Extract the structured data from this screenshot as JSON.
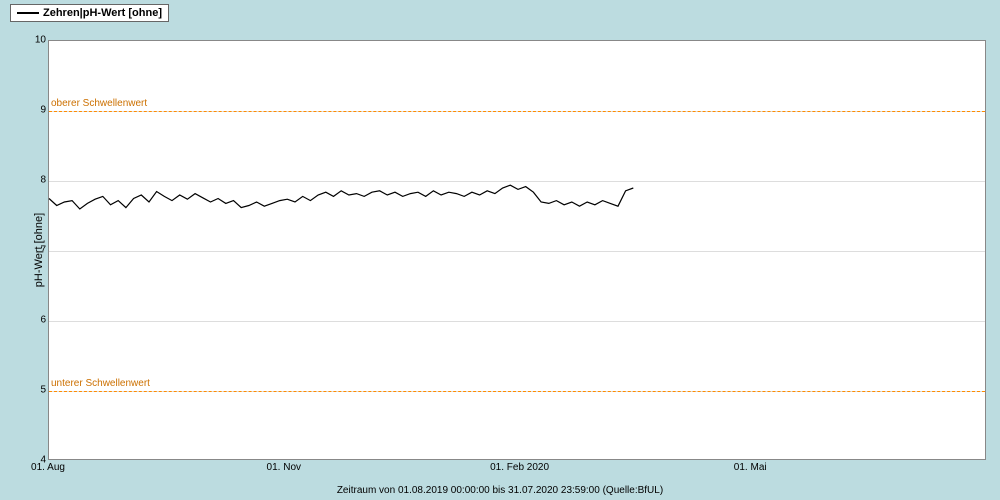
{
  "legend": {
    "label": "Zehren|pH-Wert [ohne]"
  },
  "yaxis": {
    "label": "pH-Wert [ohne]"
  },
  "xaxis": {
    "caption": "Zeitraum von 01.08.2019 00:00:00 bis 31.07.2020 23:59:00        (Quelle:BfUL)"
  },
  "thresholds": {
    "upper_label": "oberer Schwellenwert",
    "lower_label": "unterer Schwellenwert"
  },
  "chart_data": {
    "type": "line",
    "title": "Zehren|pH-Wert [ohne]",
    "xlabel": "Zeitraum von 01.08.2019 00:00:00 bis 31.07.2020 23:59:00",
    "ylabel": "pH-Wert [ohne]",
    "ylim": [
      4,
      10
    ],
    "y_ticks": [
      4,
      5,
      6,
      7,
      8,
      9,
      10
    ],
    "x_ticks": [
      "01. Aug",
      "01. Nov",
      "01. Feb 2020",
      "01. Mai"
    ],
    "x_range_days": [
      0,
      366
    ],
    "x_tick_days": [
      0,
      92,
      184,
      274
    ],
    "thresholds": {
      "upper": 9,
      "lower": 5
    },
    "series": [
      {
        "name": "Zehren pH",
        "x_days": [
          0,
          3,
          6,
          9,
          12,
          15,
          18,
          21,
          24,
          27,
          30,
          33,
          36,
          39,
          42,
          45,
          48,
          51,
          54,
          57,
          60,
          63,
          66,
          69,
          72,
          75,
          78,
          81,
          84,
          87,
          90,
          93,
          96,
          99,
          102,
          105,
          108,
          111,
          114,
          117,
          120,
          123,
          126,
          129,
          132,
          135,
          138,
          141,
          144,
          147,
          150,
          153,
          156,
          159,
          162,
          165,
          168,
          171,
          174,
          177,
          180,
          183,
          186,
          189,
          192,
          195,
          198,
          201,
          204,
          207,
          210,
          213,
          216,
          219,
          222,
          225,
          228
        ],
        "values": [
          7.75,
          7.65,
          7.7,
          7.72,
          7.6,
          7.68,
          7.74,
          7.78,
          7.66,
          7.72,
          7.62,
          7.75,
          7.8,
          7.7,
          7.85,
          7.78,
          7.72,
          7.8,
          7.74,
          7.82,
          7.76,
          7.7,
          7.75,
          7.68,
          7.72,
          7.62,
          7.65,
          7.7,
          7.64,
          7.68,
          7.72,
          7.74,
          7.7,
          7.78,
          7.72,
          7.8,
          7.84,
          7.78,
          7.86,
          7.8,
          7.82,
          7.78,
          7.84,
          7.86,
          7.8,
          7.84,
          7.78,
          7.82,
          7.84,
          7.78,
          7.86,
          7.8,
          7.84,
          7.82,
          7.78,
          7.84,
          7.8,
          7.86,
          7.82,
          7.9,
          7.94,
          7.88,
          7.92,
          7.84,
          7.7,
          7.68,
          7.72,
          7.66,
          7.7,
          7.64,
          7.7,
          7.66,
          7.72,
          7.68,
          7.64,
          7.86,
          7.9
        ]
      }
    ]
  }
}
